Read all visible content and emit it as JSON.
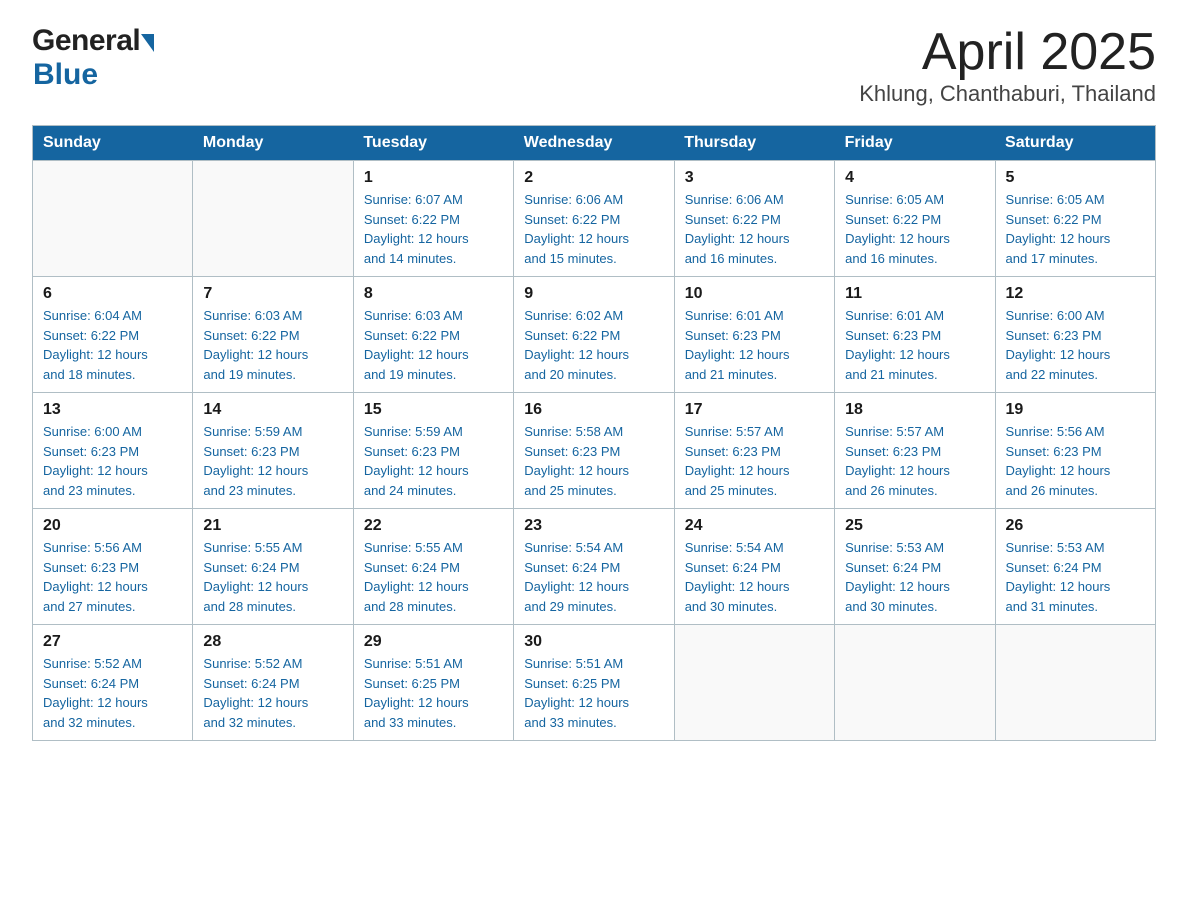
{
  "header": {
    "logo_general": "General",
    "logo_blue": "Blue",
    "title": "April 2025",
    "subtitle": "Khlung, Chanthaburi, Thailand"
  },
  "calendar": {
    "days_of_week": [
      "Sunday",
      "Monday",
      "Tuesday",
      "Wednesday",
      "Thursday",
      "Friday",
      "Saturday"
    ],
    "weeks": [
      [
        {
          "day": "",
          "info": ""
        },
        {
          "day": "",
          "info": ""
        },
        {
          "day": "1",
          "info": "Sunrise: 6:07 AM\nSunset: 6:22 PM\nDaylight: 12 hours\nand 14 minutes."
        },
        {
          "day": "2",
          "info": "Sunrise: 6:06 AM\nSunset: 6:22 PM\nDaylight: 12 hours\nand 15 minutes."
        },
        {
          "day": "3",
          "info": "Sunrise: 6:06 AM\nSunset: 6:22 PM\nDaylight: 12 hours\nand 16 minutes."
        },
        {
          "day": "4",
          "info": "Sunrise: 6:05 AM\nSunset: 6:22 PM\nDaylight: 12 hours\nand 16 minutes."
        },
        {
          "day": "5",
          "info": "Sunrise: 6:05 AM\nSunset: 6:22 PM\nDaylight: 12 hours\nand 17 minutes."
        }
      ],
      [
        {
          "day": "6",
          "info": "Sunrise: 6:04 AM\nSunset: 6:22 PM\nDaylight: 12 hours\nand 18 minutes."
        },
        {
          "day": "7",
          "info": "Sunrise: 6:03 AM\nSunset: 6:22 PM\nDaylight: 12 hours\nand 19 minutes."
        },
        {
          "day": "8",
          "info": "Sunrise: 6:03 AM\nSunset: 6:22 PM\nDaylight: 12 hours\nand 19 minutes."
        },
        {
          "day": "9",
          "info": "Sunrise: 6:02 AM\nSunset: 6:22 PM\nDaylight: 12 hours\nand 20 minutes."
        },
        {
          "day": "10",
          "info": "Sunrise: 6:01 AM\nSunset: 6:23 PM\nDaylight: 12 hours\nand 21 minutes."
        },
        {
          "day": "11",
          "info": "Sunrise: 6:01 AM\nSunset: 6:23 PM\nDaylight: 12 hours\nand 21 minutes."
        },
        {
          "day": "12",
          "info": "Sunrise: 6:00 AM\nSunset: 6:23 PM\nDaylight: 12 hours\nand 22 minutes."
        }
      ],
      [
        {
          "day": "13",
          "info": "Sunrise: 6:00 AM\nSunset: 6:23 PM\nDaylight: 12 hours\nand 23 minutes."
        },
        {
          "day": "14",
          "info": "Sunrise: 5:59 AM\nSunset: 6:23 PM\nDaylight: 12 hours\nand 23 minutes."
        },
        {
          "day": "15",
          "info": "Sunrise: 5:59 AM\nSunset: 6:23 PM\nDaylight: 12 hours\nand 24 minutes."
        },
        {
          "day": "16",
          "info": "Sunrise: 5:58 AM\nSunset: 6:23 PM\nDaylight: 12 hours\nand 25 minutes."
        },
        {
          "day": "17",
          "info": "Sunrise: 5:57 AM\nSunset: 6:23 PM\nDaylight: 12 hours\nand 25 minutes."
        },
        {
          "day": "18",
          "info": "Sunrise: 5:57 AM\nSunset: 6:23 PM\nDaylight: 12 hours\nand 26 minutes."
        },
        {
          "day": "19",
          "info": "Sunrise: 5:56 AM\nSunset: 6:23 PM\nDaylight: 12 hours\nand 26 minutes."
        }
      ],
      [
        {
          "day": "20",
          "info": "Sunrise: 5:56 AM\nSunset: 6:23 PM\nDaylight: 12 hours\nand 27 minutes."
        },
        {
          "day": "21",
          "info": "Sunrise: 5:55 AM\nSunset: 6:24 PM\nDaylight: 12 hours\nand 28 minutes."
        },
        {
          "day": "22",
          "info": "Sunrise: 5:55 AM\nSunset: 6:24 PM\nDaylight: 12 hours\nand 28 minutes."
        },
        {
          "day": "23",
          "info": "Sunrise: 5:54 AM\nSunset: 6:24 PM\nDaylight: 12 hours\nand 29 minutes."
        },
        {
          "day": "24",
          "info": "Sunrise: 5:54 AM\nSunset: 6:24 PM\nDaylight: 12 hours\nand 30 minutes."
        },
        {
          "day": "25",
          "info": "Sunrise: 5:53 AM\nSunset: 6:24 PM\nDaylight: 12 hours\nand 30 minutes."
        },
        {
          "day": "26",
          "info": "Sunrise: 5:53 AM\nSunset: 6:24 PM\nDaylight: 12 hours\nand 31 minutes."
        }
      ],
      [
        {
          "day": "27",
          "info": "Sunrise: 5:52 AM\nSunset: 6:24 PM\nDaylight: 12 hours\nand 32 minutes."
        },
        {
          "day": "28",
          "info": "Sunrise: 5:52 AM\nSunset: 6:24 PM\nDaylight: 12 hours\nand 32 minutes."
        },
        {
          "day": "29",
          "info": "Sunrise: 5:51 AM\nSunset: 6:25 PM\nDaylight: 12 hours\nand 33 minutes."
        },
        {
          "day": "30",
          "info": "Sunrise: 5:51 AM\nSunset: 6:25 PM\nDaylight: 12 hours\nand 33 minutes."
        },
        {
          "day": "",
          "info": ""
        },
        {
          "day": "",
          "info": ""
        },
        {
          "day": "",
          "info": ""
        }
      ]
    ]
  }
}
